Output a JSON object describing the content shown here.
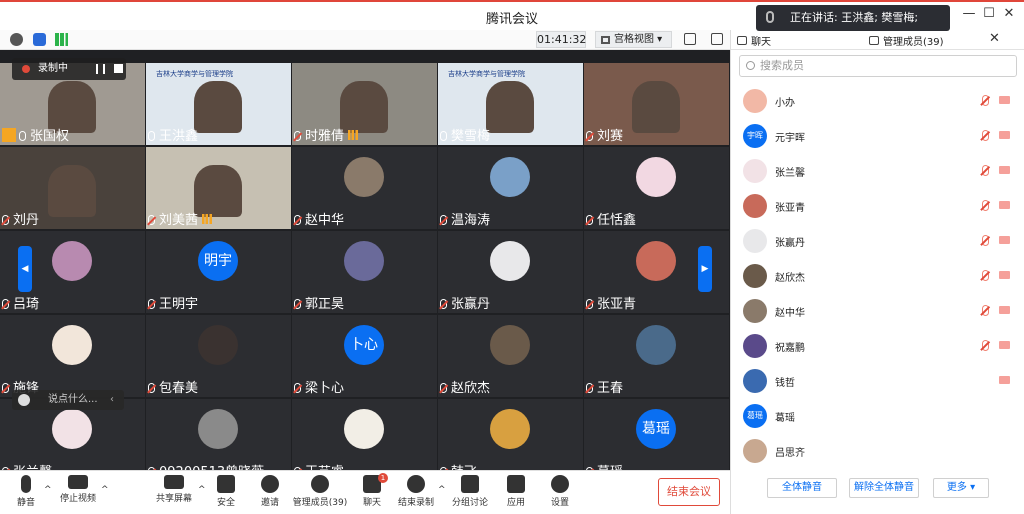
{
  "window": {
    "title": "腾讯会议",
    "speaking_text": "正在讲话: 王洪鑫; 樊雪梅;"
  },
  "toolbar": {
    "timer": "01:41:32",
    "view_label": "宫格视图"
  },
  "recording": {
    "label": "录制中"
  },
  "chat_input": {
    "placeholder": "说点什么..."
  },
  "tiles": [
    {
      "name": "张国权",
      "type": "video",
      "muted": false,
      "signal": false,
      "host": true,
      "bg": "#a09a92"
    },
    {
      "name": "王洪鑫",
      "type": "video",
      "muted": false,
      "signal": false,
      "bg": "#dfe7ee",
      "logo": "吉林大学商学与管理学院"
    },
    {
      "name": "时雅倩",
      "type": "video",
      "muted": true,
      "signal": true,
      "bg": "#8d8a82"
    },
    {
      "name": "樊雪梅",
      "type": "video",
      "muted": false,
      "signal": false,
      "bg": "#dfe7ee",
      "logo": "吉林大学商学与管理学院"
    },
    {
      "name": "刘赛",
      "type": "video",
      "muted": true,
      "signal": false,
      "bg": "#7a5a4c"
    },
    {
      "name": "刘丹",
      "type": "video",
      "muted": true,
      "signal": false,
      "bg": "#4a423c"
    },
    {
      "name": "刘美茜",
      "type": "video",
      "muted": true,
      "signal": true,
      "bg": "#c6c0b2"
    },
    {
      "name": "赵中华",
      "type": "avatar",
      "muted": true,
      "signal": false,
      "av_color": "#8a7a6a"
    },
    {
      "name": "温海涛",
      "type": "avatar",
      "muted": true,
      "signal": false,
      "av_color": "#7aa0c8"
    },
    {
      "name": "任恬鑫",
      "type": "avatar",
      "muted": true,
      "signal": false,
      "av_color": "#f2d8e2"
    },
    {
      "name": "吕琦",
      "type": "avatar",
      "muted": true,
      "signal": false,
      "av_color": "#b88ab0"
    },
    {
      "name": "王明宇",
      "type": "initial",
      "initial": "明宇",
      "muted": true,
      "signal": false
    },
    {
      "name": "郭正昊",
      "type": "avatar",
      "muted": true,
      "signal": false,
      "av_color": "#6a6a9a"
    },
    {
      "name": "张赢丹",
      "type": "avatar",
      "muted": true,
      "signal": false,
      "av_color": "#e8e8ea"
    },
    {
      "name": "张亚青",
      "type": "avatar",
      "muted": true,
      "signal": false,
      "av_color": "#c86a5a"
    },
    {
      "name": "施锋",
      "type": "avatar",
      "muted": true,
      "signal": false,
      "av_color": "#f2e6da"
    },
    {
      "name": "包春美",
      "type": "avatar",
      "muted": true,
      "signal": false,
      "av_color": "#3a3230"
    },
    {
      "name": "梁卜心",
      "type": "initial",
      "initial": "卜心",
      "muted": true,
      "signal": false
    },
    {
      "name": "赵欣杰",
      "type": "avatar",
      "muted": true,
      "signal": false,
      "av_color": "#6a5a4a"
    },
    {
      "name": "王春",
      "type": "avatar",
      "muted": true,
      "signal": false,
      "av_color": "#4a6a8a"
    },
    {
      "name": "张兰馨",
      "type": "avatar",
      "muted": true,
      "signal": false,
      "av_color": "#f2e2e6"
    },
    {
      "name": "09200513曾晓薇",
      "type": "avatar",
      "muted": true,
      "signal": false,
      "av_color": "#8a8a8a"
    },
    {
      "name": "王艺睿",
      "type": "avatar",
      "muted": true,
      "signal": false,
      "av_color": "#f2eee6"
    },
    {
      "name": "韩飞",
      "type": "avatar",
      "muted": true,
      "signal": false,
      "av_color": "#d8a040"
    },
    {
      "name": "葛瑶",
      "type": "initial",
      "initial": "葛瑶",
      "muted": true,
      "signal": false
    }
  ],
  "bottom": {
    "mute": "静音",
    "stop_video": "停止视频",
    "share": "共享屏幕",
    "security": "安全",
    "invite": "邀请",
    "members": "管理成员(39)",
    "chat": "聊天",
    "chat_badge": "1",
    "stop_record": "结束录制",
    "breakout": "分组讨论",
    "apps": "应用",
    "settings": "设置",
    "end_meeting": "结束会议"
  },
  "panel": {
    "tab_chat": "聊天",
    "tab_members": "管理成员(39)",
    "search_placeholder": "搜索成员",
    "members": [
      {
        "name": "小办",
        "avatar": "photo",
        "color": "#f2b8a6",
        "mic_muted": true,
        "cam": true
      },
      {
        "name": "元宇晖",
        "avatar": "initial",
        "initial": "宇晖",
        "mic_muted": true,
        "cam": true
      },
      {
        "name": "张兰馨",
        "avatar": "photo",
        "color": "#f2e2e6",
        "mic_muted": true,
        "cam": true
      },
      {
        "name": "张亚青",
        "avatar": "photo",
        "color": "#c86a5a",
        "mic_muted": true,
        "cam": true
      },
      {
        "name": "张赢丹",
        "avatar": "photo",
        "color": "#e8e8ea",
        "mic_muted": true,
        "cam": true
      },
      {
        "name": "赵欣杰",
        "avatar": "photo",
        "color": "#6a5a4a",
        "mic_muted": true,
        "cam": true
      },
      {
        "name": "赵中华",
        "avatar": "photo",
        "color": "#8a7a6a",
        "mic_muted": true,
        "cam": true
      },
      {
        "name": "祝嘉鹏",
        "avatar": "photo",
        "color": "#5a4a8a",
        "mic_muted": true,
        "cam": true
      },
      {
        "name": "钱哲",
        "avatar": "photo",
        "color": "#3a6ab0",
        "mic_muted": false,
        "cam": true
      },
      {
        "name": "葛瑶",
        "avatar": "initial",
        "initial": "葛瑶",
        "mic_muted": false,
        "cam": false
      },
      {
        "name": "吕思齐",
        "avatar": "photo",
        "color": "#c8a890",
        "mic_muted": false,
        "cam": false
      }
    ],
    "mute_all": "全体静音",
    "unmute_all": "解除全体静音",
    "more": "更多 ▾"
  }
}
